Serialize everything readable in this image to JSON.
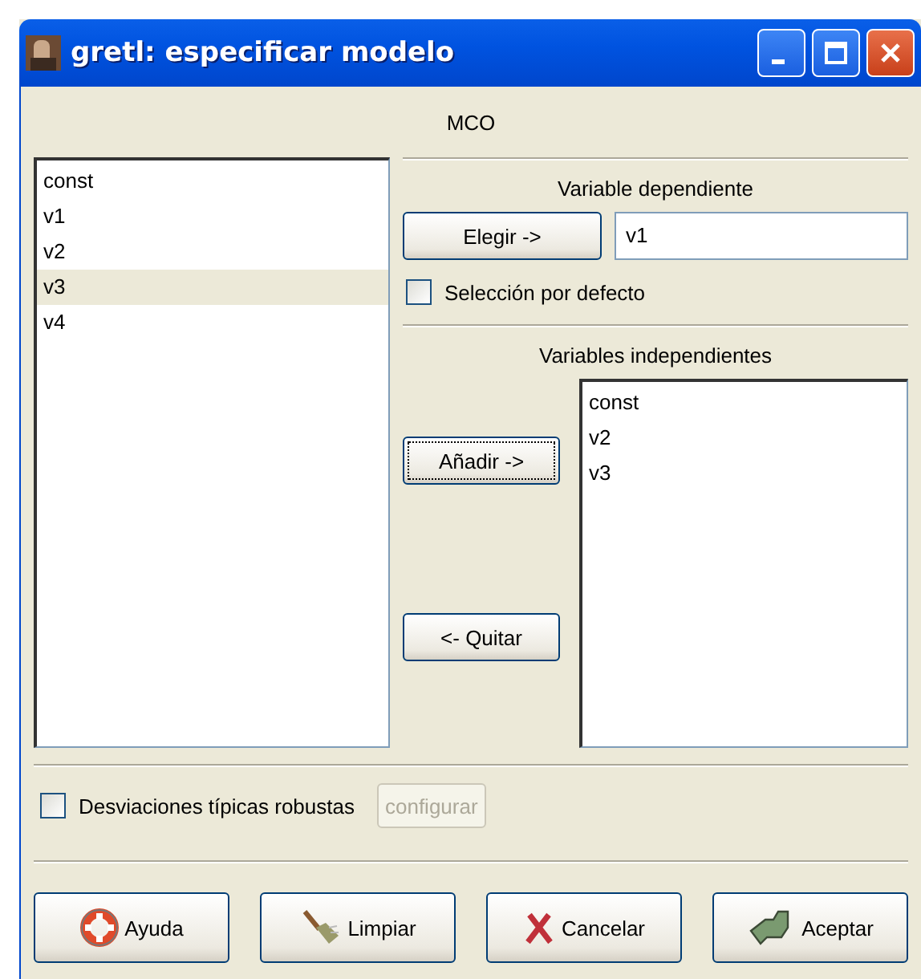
{
  "window": {
    "title": "gretl: especificar modelo"
  },
  "estimator": "MCO",
  "variables": [
    {
      "name": "const",
      "selected": false
    },
    {
      "name": "v1",
      "selected": false
    },
    {
      "name": "v2",
      "selected": false
    },
    {
      "name": "v3",
      "selected": true
    },
    {
      "name": "v4",
      "selected": false
    }
  ],
  "dependent": {
    "heading": "Variable dependiente",
    "choose_button": "Elegir ->",
    "value": "v1",
    "default_selection": {
      "label": "Selección por defecto",
      "checked": false
    }
  },
  "independent": {
    "heading": "Variables independientes",
    "add_button": "Añadir ->",
    "remove_button": "<- Quitar",
    "items": [
      "const",
      "v2",
      "v3"
    ]
  },
  "robust": {
    "label": "Desviaciones típicas robustas",
    "checked": false,
    "configure_button": {
      "label": "configurar",
      "disabled": true
    }
  },
  "buttons": [
    {
      "kind": "help",
      "label": "Ayuda"
    },
    {
      "kind": "clear",
      "label": "Limpiar"
    },
    {
      "kind": "cancel",
      "label": "Cancelar"
    },
    {
      "kind": "ok",
      "label": "Aceptar"
    }
  ]
}
